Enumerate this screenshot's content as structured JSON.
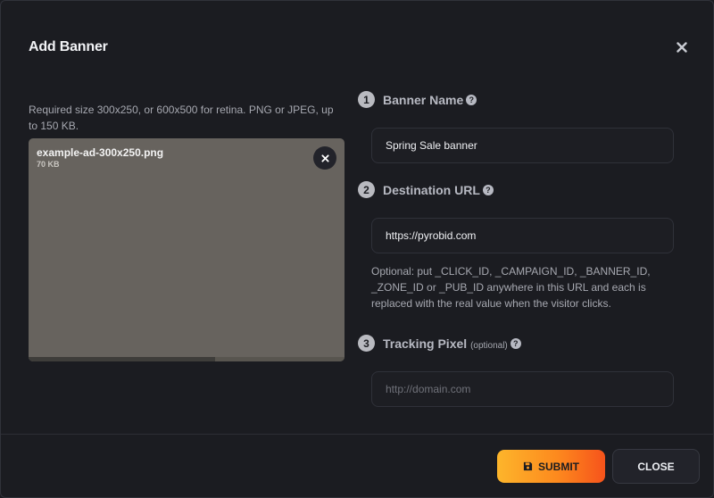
{
  "dialog": {
    "title": "Add Banner",
    "close_icon": "close-icon"
  },
  "upload": {
    "hint": "Required size 300x250, or 600x500 for retina. PNG or JPEG, up to 150 KB.",
    "file_name": "example-ad-300x250.png",
    "file_size": "70 KB",
    "progress": 0.59,
    "preview_color": "#67635e",
    "remove_icon": "close-icon"
  },
  "form": {
    "banner_name": {
      "step": "1",
      "label": "Banner Name",
      "value": "Spring Sale banner"
    },
    "destination_url": {
      "step": "2",
      "label": "Destination URL",
      "value": "https://pyrobid.com",
      "note": "Optional: put _CLICK_ID, _CAMPAIGN_ID, _BANNER_ID, _ZONE_ID or _PUB_ID anywhere in this URL and each is replaced with the real value when the visitor clicks."
    },
    "tracking_pixel": {
      "step": "3",
      "label": "Tracking Pixel",
      "optional": "(optional)",
      "placeholder": "http://domain.com",
      "value": ""
    },
    "help_icon": "question-circle-icon"
  },
  "footer": {
    "submit_label": "SUBMIT",
    "submit_icon": "floppy-disk-icon",
    "close_label": "CLOSE"
  },
  "colors": {
    "background": "#1b1c21",
    "accent_start": "#fdb52b",
    "accent_end": "#f6531b"
  }
}
